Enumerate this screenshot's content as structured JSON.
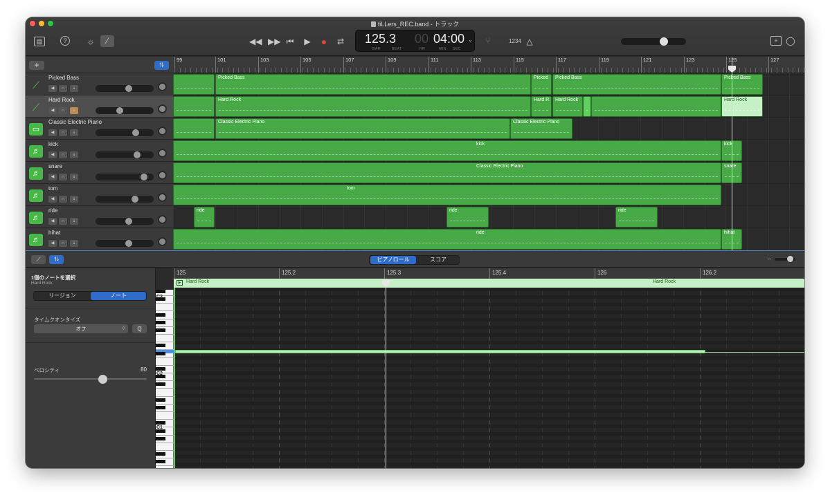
{
  "window": {
    "title": "fiLLers_REC.band - トラック"
  },
  "toolbar": {
    "library_icon": "library-icon",
    "help_icon": "help-icon",
    "smart_controls_icon": "smart-controls-icon",
    "editors_icon": "pencil-icon",
    "rewind_icon": "rewind-icon",
    "forward_icon": "fast-forward-icon",
    "to_start_icon": "go-to-beginning-icon",
    "play_icon": "play-icon",
    "record_icon": "record-icon",
    "cycle_icon": "cycle-icon",
    "lcd": {
      "bar_beat": "125.3",
      "hr": "00",
      "min_sec": "04:00",
      "bar_label": "BAR",
      "beat_label": "BEAT",
      "hr_label": "HR",
      "min_label": "MIN",
      "sec_label": "SEC"
    },
    "count_in": "1234",
    "master_volume": 0.66
  },
  "tracks_header": {
    "add_label": "+"
  },
  "ruler": {
    "bars": [
      "99",
      "101",
      "103",
      "105",
      "107",
      "109",
      "111",
      "113",
      "115",
      "117",
      "119",
      "121",
      "123",
      "125",
      "127"
    ]
  },
  "tracks": [
    {
      "name": "Picked Bass",
      "type": "bass",
      "selected": false,
      "volume": 0.58
    },
    {
      "name": "Hard Rock",
      "type": "guitar",
      "selected": true,
      "volume": 0.4
    },
    {
      "name": "Classic Electric Piano",
      "type": "keyboard",
      "selected": false,
      "volume": 0.72
    },
    {
      "name": "kick",
      "type": "drums",
      "selected": false,
      "volume": 0.74
    },
    {
      "name": "snare",
      "type": "drums",
      "selected": false,
      "volume": 0.88
    },
    {
      "name": "tom",
      "type": "drums",
      "selected": false,
      "volume": 0.7
    },
    {
      "name": "ride",
      "type": "drums",
      "selected": false,
      "volume": 0.58
    },
    {
      "name": "hihat",
      "type": "drums",
      "selected": false,
      "volume": 0.58
    }
  ],
  "regions": {
    "r0": [
      "Picked Bass",
      "Picked",
      "Picked Bass",
      "Picked Bass"
    ],
    "r1": [
      "Hard Rock",
      "Hard R",
      "Hard Rock",
      "Hard Rock"
    ],
    "r2": [
      "Classic Electric Piano",
      "Classic Electric Piano"
    ],
    "r3": [
      "kick",
      "kick"
    ],
    "r4": [
      "Classic Electric Piano",
      "snare"
    ],
    "r5": [
      "tom"
    ],
    "r6": [
      "ride",
      "ride",
      "ride"
    ],
    "r7": [
      "ride",
      "hihat"
    ]
  },
  "editor": {
    "tabs": [
      "ピアノロール",
      "スコア"
    ],
    "inspector_title": "1個のノートを選択",
    "inspector_subtitle": "Hard Rock",
    "segment": [
      "リージョン",
      "ノート"
    ],
    "quantize_label": "タイムクオンタイズ",
    "quantize_value": "オフ",
    "quantize_button": "Q",
    "velocity_label": "ベロシティ",
    "velocity_value": "80",
    "ruler": [
      "125",
      "125.2",
      "125.3",
      "125.4",
      "126",
      "126.2"
    ],
    "region_name": "Hard Rock",
    "octaves": [
      "C3",
      "C2",
      "C1"
    ]
  }
}
